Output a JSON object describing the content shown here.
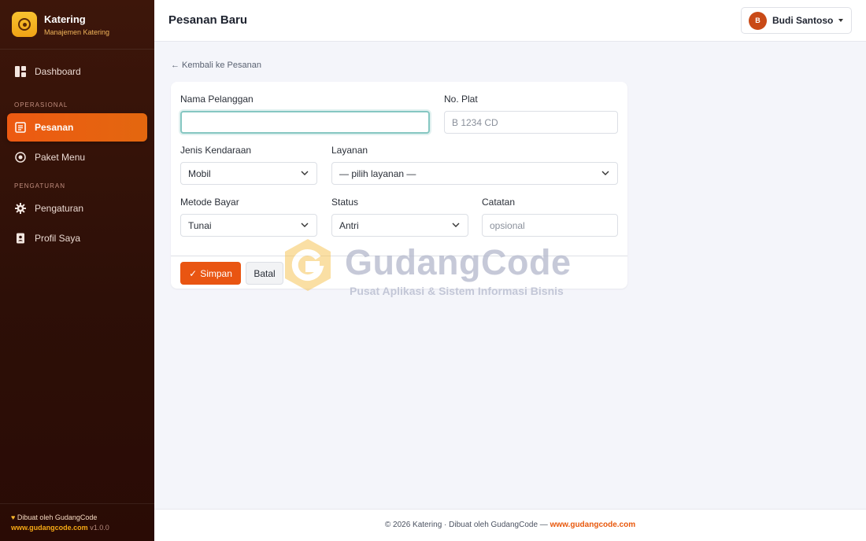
{
  "brand": {
    "title": "Katering",
    "subtitle": "Manajemen Katering"
  },
  "sidebar": {
    "items": [
      {
        "label": "Dashboard",
        "icon": "dashboard-icon"
      },
      {
        "section": "OPERASIONAL"
      },
      {
        "label": "Pesanan",
        "icon": "receipt-icon",
        "active": true
      },
      {
        "label": "Paket Menu",
        "icon": "target-icon"
      },
      {
        "section": "PENGATURAN"
      },
      {
        "label": "Pengaturan",
        "icon": "gear-icon"
      },
      {
        "label": "Profil Saya",
        "icon": "id-badge-icon"
      }
    ],
    "footer": {
      "line1": "Dibuat oleh GudangCode",
      "site": "www.gudangcode.com",
      "version": "v1.0.0"
    }
  },
  "header": {
    "title": "Pesanan Baru",
    "user": {
      "name": "Budi Santoso",
      "initial": "B"
    }
  },
  "main": {
    "back_link": "← Kembali ke Pesanan",
    "form": {
      "nama_pelanggan": {
        "label": "Nama Pelanggan",
        "value": ""
      },
      "no_plat": {
        "label": "No. Plat",
        "placeholder": "B 1234 CD"
      },
      "jenis_kendaraan": {
        "label": "Jenis Kendaraan",
        "value": "Mobil"
      },
      "layanan": {
        "label": "Layanan",
        "value": "— pilih layanan —"
      },
      "metode_bayar": {
        "label": "Metode Bayar",
        "value": "Tunai"
      },
      "status": {
        "label": "Status",
        "value": "Antri"
      },
      "catatan": {
        "label": "Catatan",
        "placeholder": "opsional"
      }
    },
    "buttons": {
      "save": "Simpan",
      "cancel": "Batal"
    }
  },
  "watermark": {
    "title": "GudangCode",
    "subtitle": "Pusat Aplikasi & Sistem Informasi Bisnis"
  },
  "footer": {
    "text": "© 2026 Katering · Dibuat oleh GudangCode — ",
    "site": "www.gudangcode.com"
  },
  "colors": {
    "accent": "#e95512",
    "sidebar_bg": "#2d0f07",
    "brand_yellow": "#f7b52c"
  }
}
